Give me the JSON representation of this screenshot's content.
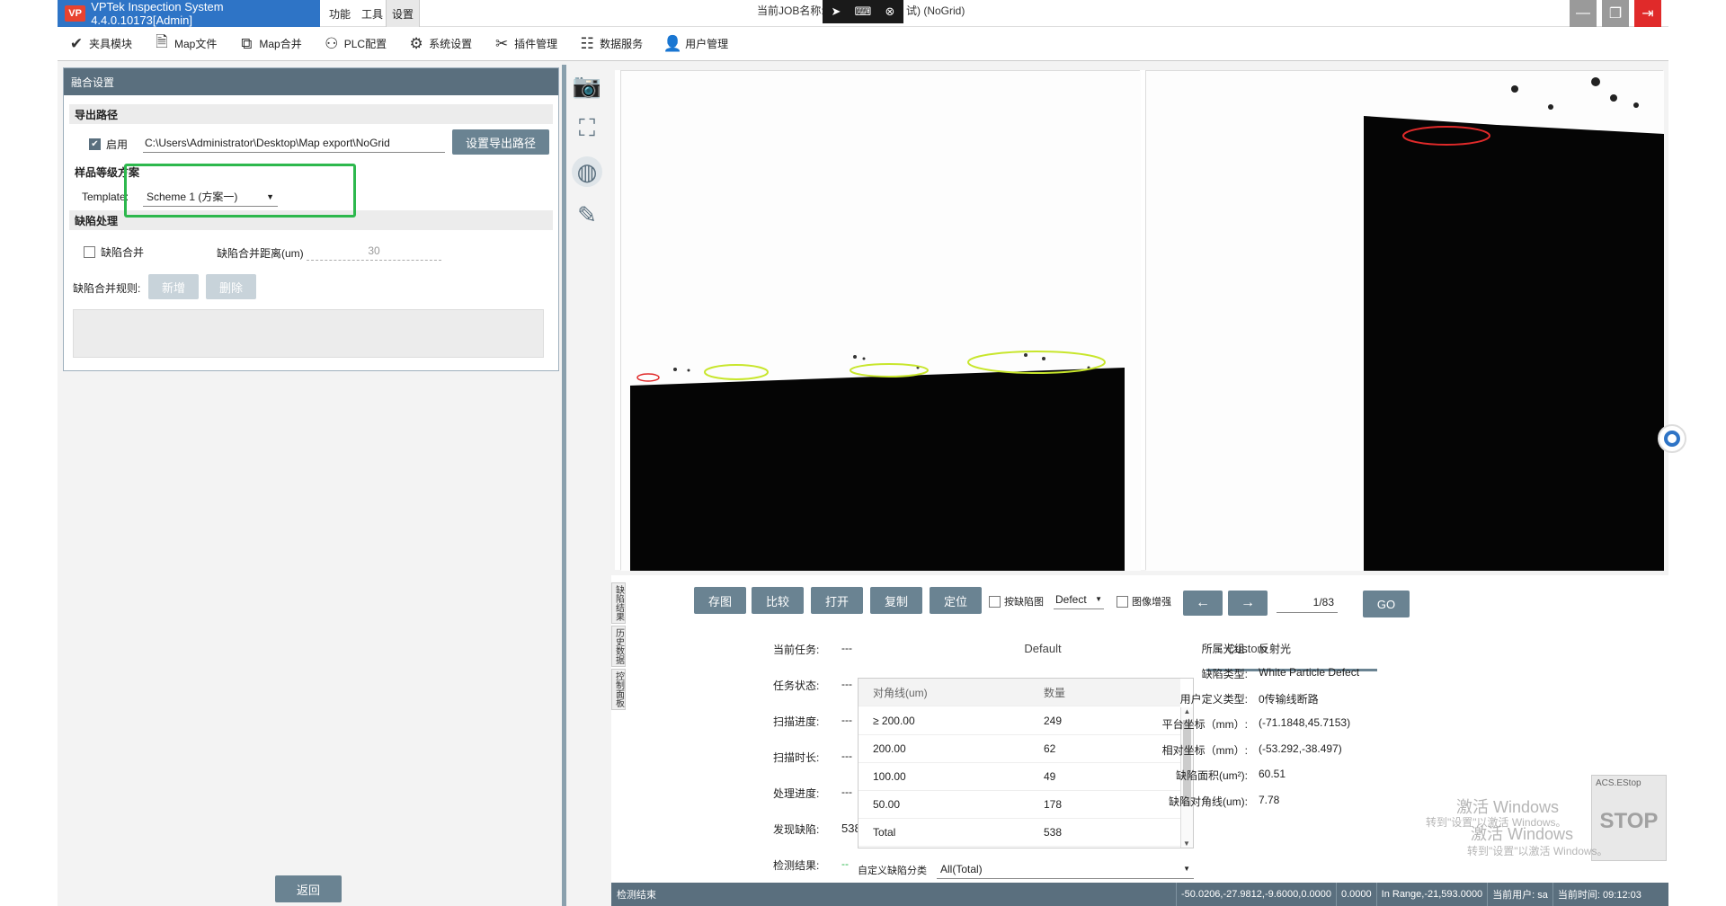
{
  "app": {
    "title": "VPTek Inspection System 4.4.0.10173[Admin]",
    "logo": "VP",
    "menus": [
      "功能",
      "工具",
      "设置"
    ],
    "job_label": "当前JOB名称:",
    "job_value": "试) (NoGrid)",
    "media_icons": [
      "cursor-icon",
      "keyboard-icon",
      "close-icon"
    ]
  },
  "toolbar": {
    "items": [
      {
        "label": "夹具模块",
        "icon": "fixture-icon"
      },
      {
        "label": "Map文件",
        "icon": "document-icon"
      },
      {
        "label": "Map合并",
        "icon": "merge-icon"
      },
      {
        "label": "PLC配置",
        "icon": "plc-icon"
      },
      {
        "label": "系统设置",
        "icon": "gear-icon"
      },
      {
        "label": "插件管理",
        "icon": "tools-icon"
      },
      {
        "label": "数据服务",
        "icon": "database-icon"
      },
      {
        "label": "用户管理",
        "icon": "user-icon"
      }
    ]
  },
  "left_panel": {
    "header": "融合设置",
    "export_section": "导出路径",
    "enable_label": "启用",
    "export_path": "C:\\Users\\Administrator\\Desktop\\Map export\\NoGrid",
    "set_export_button": "设置导出路径",
    "grade_section": "样品等级方案",
    "template_label": "Template:",
    "template_value": "Scheme 1 (方案一)",
    "defect_section": "缺陷处理",
    "merge_label": "缺陷合并",
    "merge_distance_label": "缺陷合并距离(um)",
    "merge_distance_value": "30",
    "merge_rule_label": "缺陷合并规则:",
    "add_button": "新增",
    "delete_button": "删除",
    "back_button": "返回"
  },
  "results": {
    "vtabs": [
      "缺陷结果",
      "历史数据",
      "控制面板"
    ],
    "buttons": [
      "存图",
      "比较",
      "打开",
      "复制",
      "定位"
    ],
    "by_defect_label": "按缺陷图",
    "defect_select": "Defect",
    "enhance_label": "图像增强",
    "prev_arrow": "←",
    "next_arrow": "→",
    "page": "1/83",
    "go_button": "GO",
    "fields": [
      {
        "label": "当前任务:",
        "value": "---"
      },
      {
        "label": "任务状态:",
        "value": "---"
      },
      {
        "label": "扫描进度:",
        "value": "---"
      },
      {
        "label": "扫描时长:",
        "value": "---"
      },
      {
        "label": "处理进度:",
        "value": "---"
      },
      {
        "label": "发现缺陷:",
        "value": "538"
      },
      {
        "label": "检测结果:",
        "value": "--"
      }
    ],
    "tabs": [
      "Default",
      "Custom"
    ],
    "table_headers": [
      "对角线(um)",
      "数量"
    ],
    "table_rows": [
      {
        "size": "≥ 200.00",
        "count": "249"
      },
      {
        "size": "200.00",
        "count": "62"
      },
      {
        "size": "100.00",
        "count": "49"
      },
      {
        "size": "50.00",
        "count": "178"
      },
      {
        "size": "Total",
        "count": "538"
      }
    ],
    "custom_class_label": "自定义缺陷分类",
    "custom_class_value": "All(Total)",
    "info": [
      {
        "label": "所属光组:",
        "value": "反射光"
      },
      {
        "label": "缺陷类型:",
        "value": "White Particle Defect"
      },
      {
        "label": "用户定义类型:",
        "value": "0传输线断路"
      },
      {
        "label": "平台坐标（mm）:",
        "value": "(-71.1848,45.7153)"
      },
      {
        "label": "相对坐标（mm）:",
        "value": "(-53.292,-38.497)"
      },
      {
        "label": "缺陷面积(um²):",
        "value": "60.51"
      },
      {
        "label": "缺陷对角线(um):",
        "value": "7.78"
      }
    ]
  },
  "statusbar": {
    "left": "检测结束",
    "cells": [
      "-50.0206,-27.9812,-9.6000,0.0000",
      "0.0000",
      "In Range,-21,593.0000",
      "当前用户: sa",
      "当前时间: 09:12:03"
    ]
  },
  "overlay": {
    "estop_label": "ACS.EStop",
    "estop_text": "STOP",
    "watermark_main": "激活 Windows",
    "watermark_sub": "转到\"设置\"以激活 Windows。"
  },
  "colors": {
    "accent": "#2e74c6",
    "panel": "#5a6f7e",
    "button": "#6a8392",
    "highlight": "#2db84d"
  }
}
